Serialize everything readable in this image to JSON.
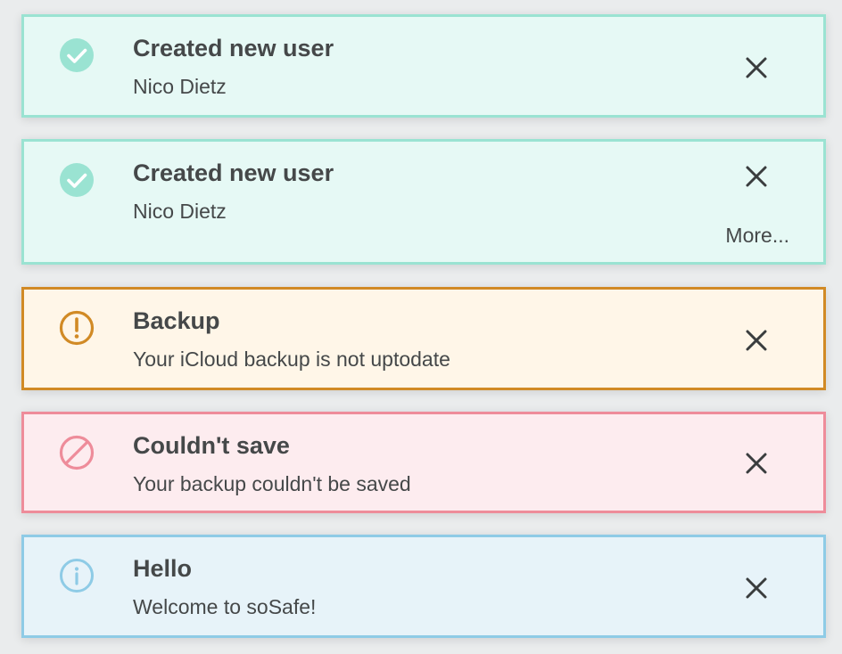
{
  "toasts": [
    {
      "type": "success",
      "icon": "check-circle-icon",
      "title": "Created new user",
      "message": "Nico Dietz",
      "close_label": "Close"
    },
    {
      "type": "success",
      "icon": "check-circle-icon",
      "title": "Created new user",
      "message": "Nico Dietz",
      "more_label": "More...",
      "close_label": "Close"
    },
    {
      "type": "warning",
      "icon": "exclamation-circle-icon",
      "title": "Backup",
      "message": "Your iCloud backup is not uptodate",
      "close_label": "Close"
    },
    {
      "type": "error",
      "icon": "prohibited-icon",
      "title": "Couldn't save",
      "message": "Your backup couldn't be saved",
      "close_label": "Close"
    },
    {
      "type": "info",
      "icon": "info-circle-icon",
      "title": "Hello",
      "message": "Welcome to soSafe!",
      "close_label": "Close"
    }
  ],
  "colors": {
    "success_bg": "#e6f9f5",
    "success_border": "#9ae3d2",
    "warning_bg": "#fff6e8",
    "warning_border": "#d18a25",
    "error_bg": "#fdecef",
    "error_border": "#ee8c9a",
    "info_bg": "#e7f3f9",
    "info_border": "#8ecbe6",
    "text": "#454849"
  }
}
